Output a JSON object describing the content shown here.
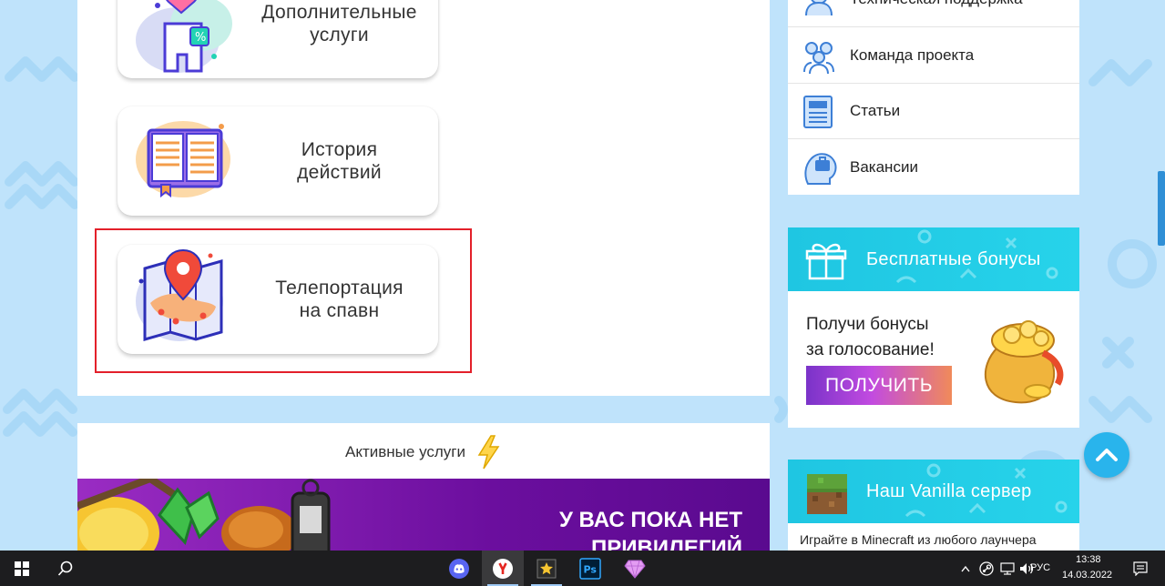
{
  "cards": [
    {
      "label": "Дополнительные\nуслуги"
    },
    {
      "label": "История\nдействий"
    },
    {
      "label": "Телепортация\nна спавн"
    }
  ],
  "active_services": {
    "title": "Активные услуги",
    "banner_text": "У ВАС ПОКА НЕТ ПРИВИЛЕГИЙ"
  },
  "menu": {
    "items": [
      {
        "label": "Техническая поддержка"
      },
      {
        "label": "Команда проекта"
      },
      {
        "label": "Статьи"
      },
      {
        "label": "Вакансии"
      }
    ]
  },
  "bonus_widget": {
    "title": "Бесплатные бонусы",
    "text_line1": "Получи бонусы",
    "text_line2": "за голосование!",
    "button_label": "ПОЛУЧИТЬ"
  },
  "vanilla_widget": {
    "title": "Наш Vanilla сервер",
    "subtitle": "Играйте в Minecraft из любого лаунчера"
  },
  "taskbar": {
    "language": "РУС",
    "time": "13:38",
    "date": "14.03.2022"
  },
  "colors": {
    "background": "#bfe3fb",
    "accent_cyan": "#1fc6e2",
    "highlight_red": "#e3202a",
    "promo_purple": "#7a1ab0"
  }
}
